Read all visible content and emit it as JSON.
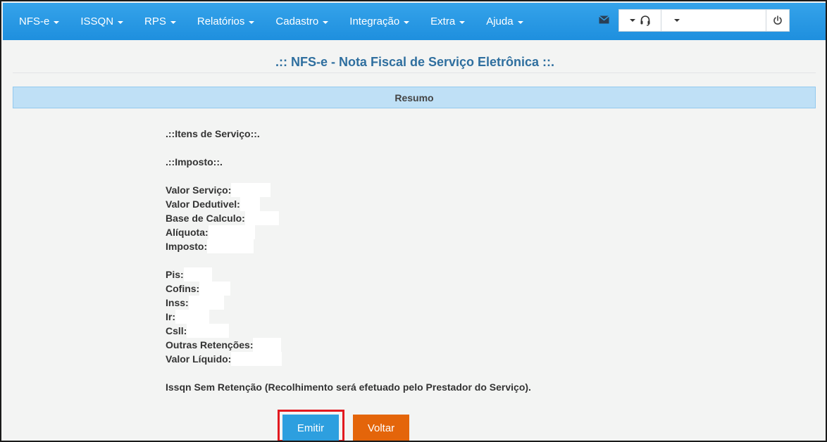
{
  "nav": {
    "items": [
      {
        "label": "NFS-e"
      },
      {
        "label": "ISSQN"
      },
      {
        "label": "RPS"
      },
      {
        "label": "Relatórios"
      },
      {
        "label": "Cadastro"
      },
      {
        "label": "Integração"
      },
      {
        "label": "Extra"
      },
      {
        "label": "Ajuda"
      }
    ],
    "icons": {
      "mail": "envelope-icon",
      "support": "headset-icon",
      "power": "power-icon"
    }
  },
  "page": {
    "title": ".:: NFS-e - Nota Fiscal de Serviço Eletrônica ::.",
    "section": "Resumo"
  },
  "summary": {
    "itens": ".::Itens de Serviço::.",
    "imposto": ".::Imposto::.",
    "valor_servico": "Valor Serviço:",
    "valor_dedutivel": "Valor Dedutivel:",
    "base_calculo": "Base de Calculo:",
    "aliquota": "Alíquota:",
    "imposto_label": "Imposto:",
    "pis": "Pis:",
    "cofins": "Cofins:",
    "inss": "Inss:",
    "ir": "Ir:",
    "csll": "Csll:",
    "outras": "Outras Retenções:",
    "valor_liquido": "Valor Líquido:",
    "note": "Issqn Sem Retenção (Recolhimento será efetuado pelo Prestador do Serviço)."
  },
  "buttons": {
    "emitir": "Emitir",
    "voltar": "Voltar"
  },
  "colors": {
    "navbar": "#2196e6",
    "title": "#2f6f9f",
    "section_bar": "#bfe0f6",
    "emitir": "#2d9fdf",
    "voltar": "#e4650a",
    "highlight": "#e2191f"
  }
}
